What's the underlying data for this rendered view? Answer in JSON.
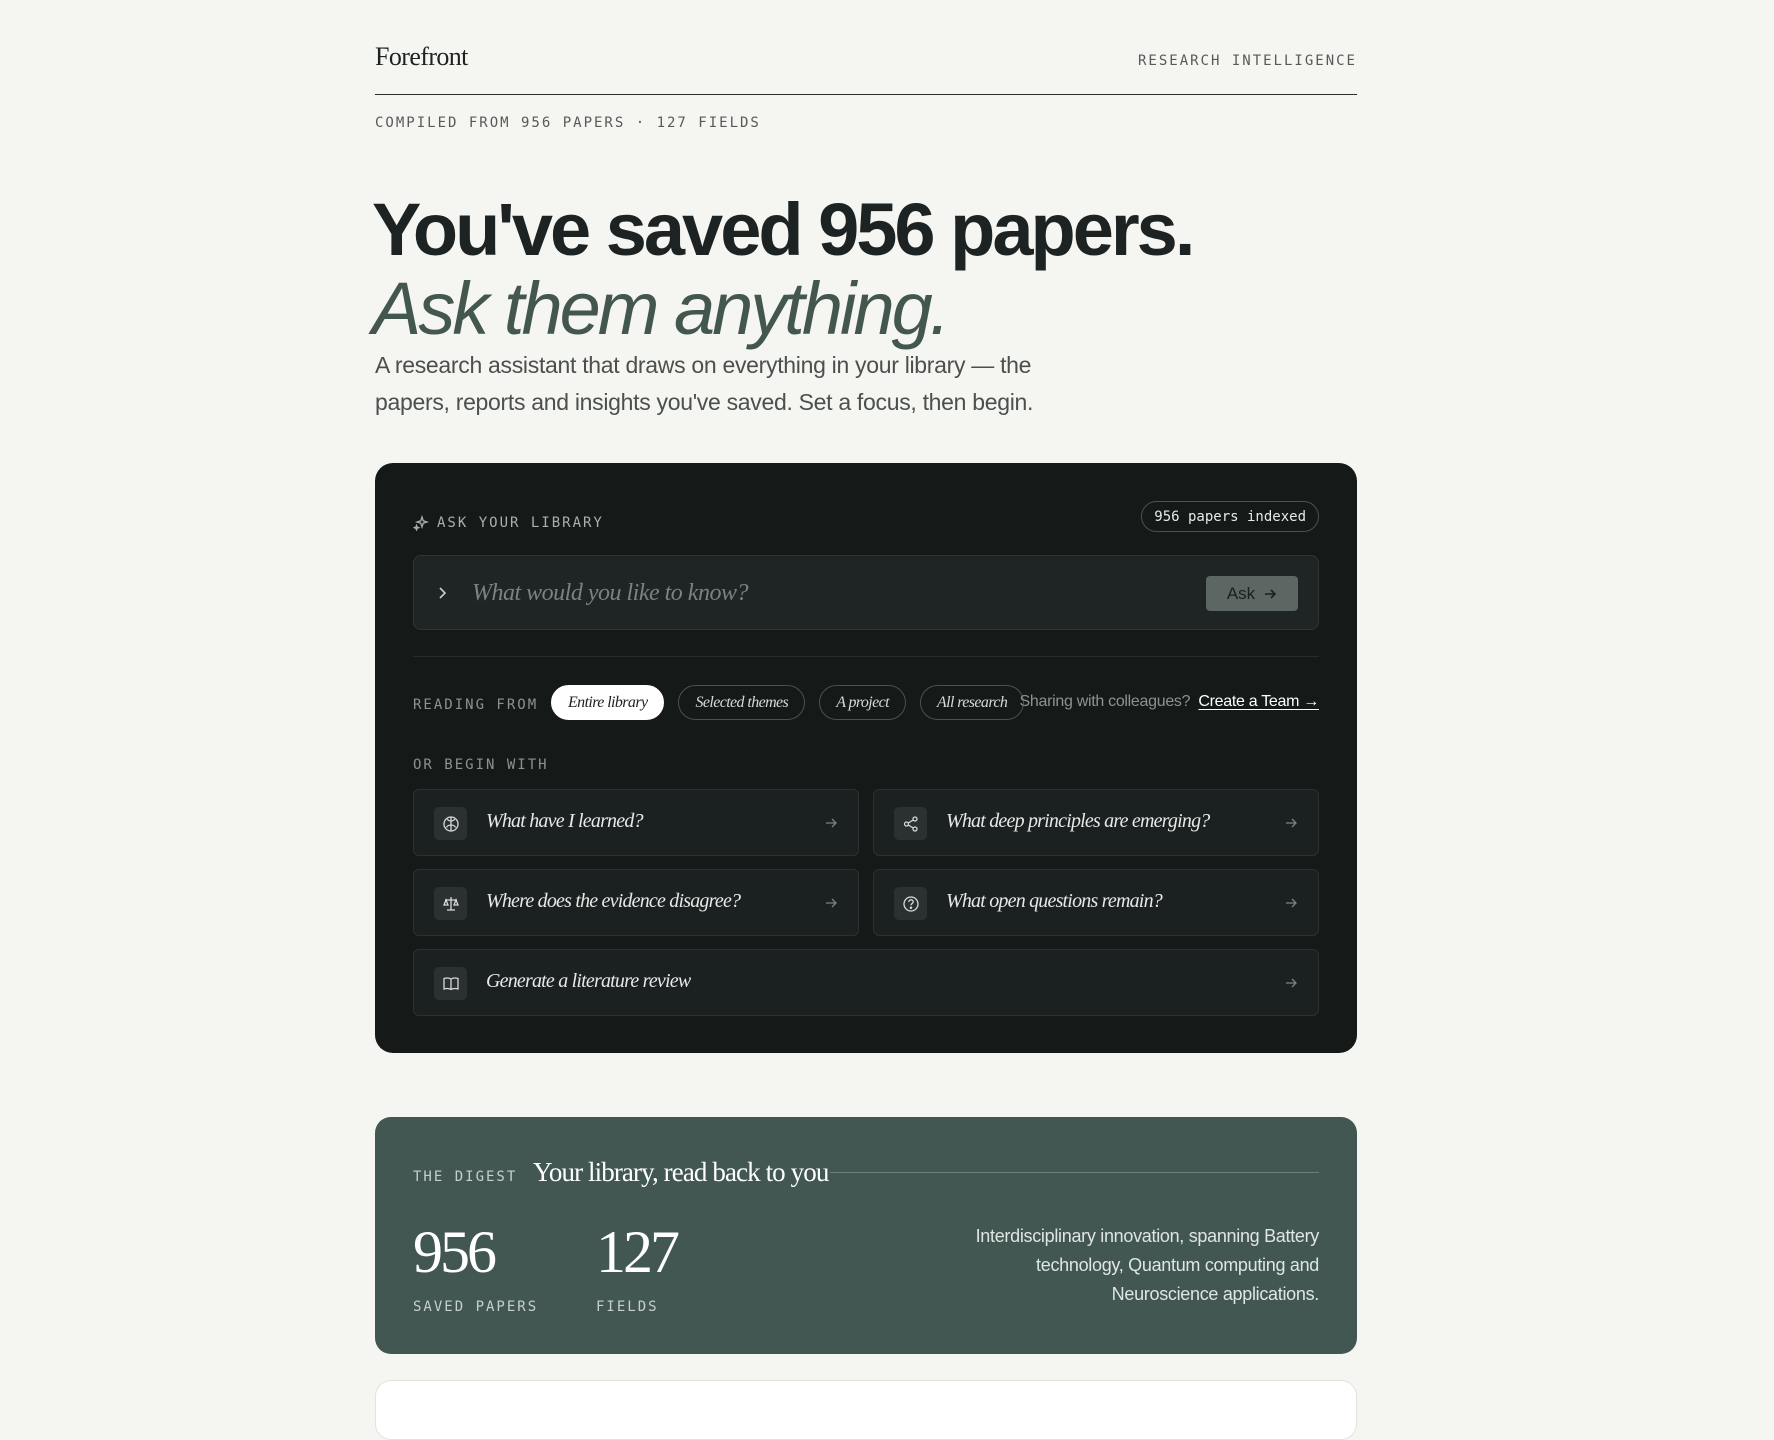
{
  "header": {
    "brand": "Forefront",
    "tagline": "RESEARCH INTELLIGENCE",
    "compiled": "COMPILED FROM 956 PAPERS · 127 FIELDS"
  },
  "hero": {
    "line1": "You've saved 956 papers.",
    "line2": "Ask them anything.",
    "lede": "A research assistant that draws on everything in your library — the papers, reports and insights you've saved. Set a focus, then begin."
  },
  "ask": {
    "heading": "ASK YOUR LIBRARY",
    "indexed_badge": "956 papers indexed",
    "query_placeholder": "What would you like to know?",
    "query_value": "",
    "ask_button": "Ask",
    "reading_from_label": "READING FROM",
    "scopes": [
      {
        "label": "Entire library",
        "active": true
      },
      {
        "label": "Selected themes",
        "active": false
      },
      {
        "label": "A project",
        "active": false
      },
      {
        "label": "All research",
        "active": false
      }
    ],
    "sharing_text": "Sharing with colleagues?",
    "team_link": "Create a Team →",
    "begin_label": "OR BEGIN WITH",
    "prompts": [
      {
        "label": "What have I learned?",
        "icon": "brain-icon"
      },
      {
        "label": "What deep principles are emerging?",
        "icon": "share-nodes-icon"
      },
      {
        "label": "Where does the evidence disagree?",
        "icon": "scale-icon"
      },
      {
        "label": "What open questions remain?",
        "icon": "question-circle-icon"
      },
      {
        "label": "Generate a literature review",
        "icon": "open-book-icon"
      }
    ]
  },
  "digest": {
    "label": "THE DIGEST",
    "title": "Your library, read back to you",
    "stats": [
      {
        "value": "956",
        "label": "SAVED PAPERS"
      },
      {
        "value": "127",
        "label": "FIELDS"
      }
    ],
    "summary": "Interdisciplinary innovation, spanning Battery technology, Quantum computing and Neuroscience applications."
  },
  "colors": {
    "page_bg": "#f5f5f1",
    "ask_card_bg": "#151a19",
    "digest_bg": "#425752",
    "accent_italic": "#44574f"
  }
}
